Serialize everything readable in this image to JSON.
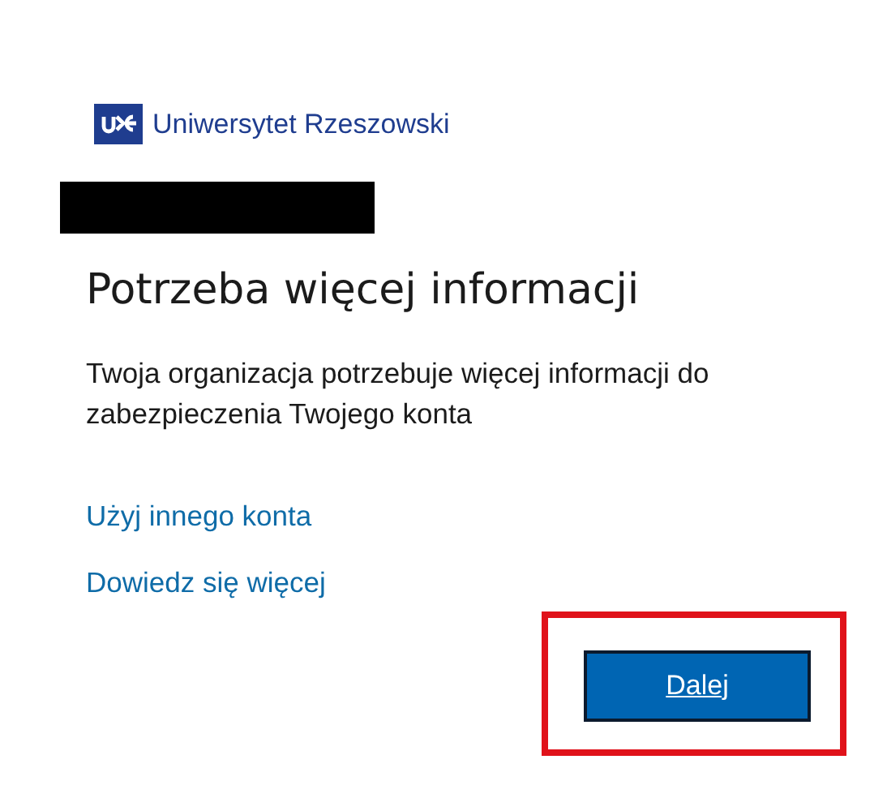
{
  "logo": {
    "text": "Uniwersytet Rzeszowski"
  },
  "heading": "Potrzeba więcej informacji",
  "description": "Twoja organizacja potrzebuje więcej informacji do zabezpieczenia Twojego konta",
  "links": [
    "Użyj innego konta",
    "Dowiedz się więcej"
  ],
  "next_button": "Dalej"
}
